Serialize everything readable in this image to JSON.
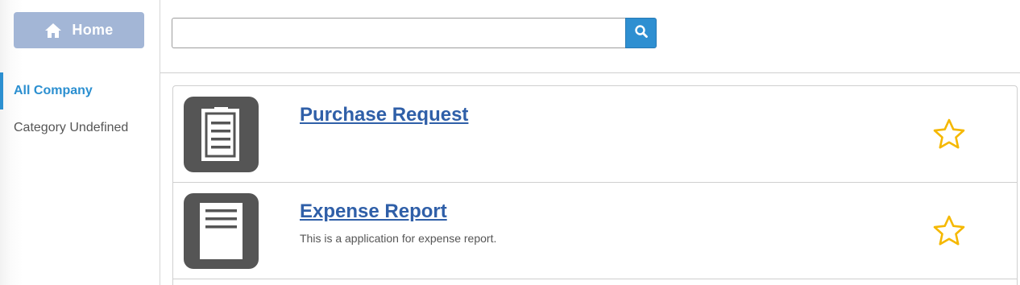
{
  "sidebar": {
    "home_label": "Home",
    "home_icon": "home-icon",
    "categories": [
      {
        "label": "All Company",
        "active": true
      },
      {
        "label": "Category Undefined",
        "active": false
      }
    ]
  },
  "search": {
    "value": "",
    "placeholder": "",
    "button_icon": "search-icon"
  },
  "apps": [
    {
      "title": "Purchase Request",
      "description": "",
      "icon": "clipboard-icon",
      "favorite": false
    },
    {
      "title": "Expense Report",
      "description": "This is a application for expense report.",
      "icon": "document-icon",
      "favorite": false
    }
  ],
  "colors": {
    "accent": "#2b8fd0",
    "home_button": "#a3b6d6",
    "link": "#2f5fa8",
    "icon_bg": "#555555",
    "star": "#f5b800"
  }
}
